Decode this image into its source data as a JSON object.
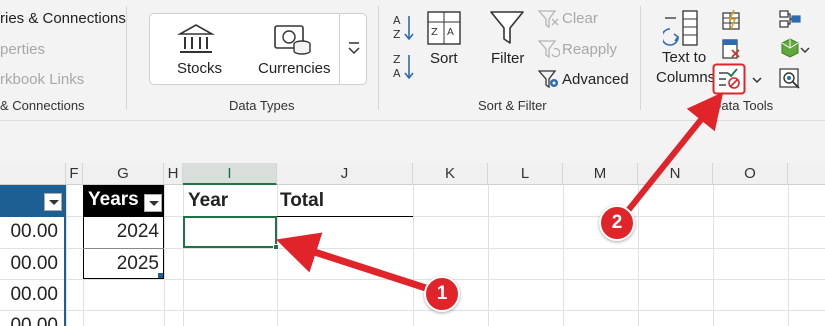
{
  "ribbon": {
    "queries": {
      "queries_connections": "ries & Connections",
      "properties": "perties",
      "workbook_links": "rkbook Links",
      "group_label": "& Connections"
    },
    "data_types": {
      "stocks": "Stocks",
      "currencies": "Currencies",
      "group_label": "Data Types"
    },
    "sort_filter": {
      "sort": "Sort",
      "filter": "Filter",
      "clear": "Clear",
      "reapply": "Reapply",
      "advanced": "Advanced",
      "group_label": "Sort & Filter"
    },
    "data_tools": {
      "text_to_columns_1": "Text to",
      "text_to_columns_2": "Columns",
      "group_label": "Data Tools"
    }
  },
  "grid": {
    "column_headers": [
      "F",
      "G",
      "H",
      "I",
      "J",
      "K",
      "L",
      "M",
      "N",
      "O"
    ],
    "selected_column": "I",
    "left_values": [
      "00.00",
      "00.00",
      "00.00",
      "00.00",
      "00.00"
    ],
    "years_header": "Years",
    "years": [
      "2024",
      "2025"
    ],
    "year_label": "Year",
    "total_label": "Total"
  },
  "annotations": {
    "callout_1": "1",
    "callout_2": "2",
    "color": "#e0242a"
  },
  "colors": {
    "excel_green": "#217346",
    "table_blue": "#1e5f93"
  }
}
